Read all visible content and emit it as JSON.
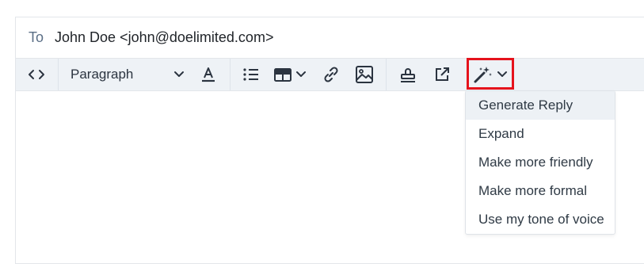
{
  "to": {
    "label": "To",
    "value": "John Doe <john@doelimited.com>"
  },
  "toolbar": {
    "items": [
      {
        "name": "code-view-icon",
        "type": "icon"
      },
      {
        "name": "paragraph-select",
        "label": "Paragraph"
      },
      {
        "name": "text-color-icon",
        "type": "icon"
      },
      {
        "name": "bulleted-list-icon",
        "type": "icon"
      },
      {
        "name": "table-icon",
        "type": "icon"
      },
      {
        "name": "link-icon",
        "type": "icon"
      },
      {
        "name": "image-icon",
        "type": "icon"
      },
      {
        "name": "stamp-icon",
        "type": "icon"
      },
      {
        "name": "external-link-icon",
        "type": "icon"
      },
      {
        "name": "magic-wand-icon",
        "type": "icon"
      }
    ],
    "highlight_color": "#e5131c"
  },
  "ai_menu": {
    "items": [
      {
        "label": "Generate Reply",
        "active": true
      },
      {
        "label": "Expand"
      },
      {
        "label": "Make more friendly"
      },
      {
        "label": "Make more formal"
      },
      {
        "label": "Use my tone of voice"
      }
    ]
  }
}
